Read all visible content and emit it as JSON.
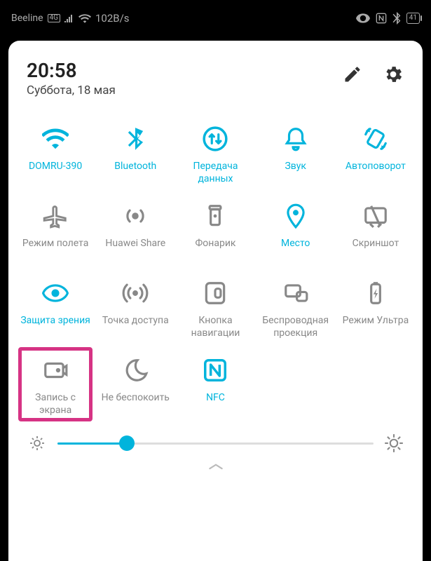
{
  "statusbar": {
    "carrier": "Beeline",
    "network_badge": "4G",
    "speed": "102B/s",
    "battery": "41"
  },
  "header": {
    "time": "20:58",
    "date": "Суббота, 18 мая"
  },
  "tiles": [
    {
      "id": "wifi",
      "label": "DOMRU-390",
      "active": true,
      "icon": "wifi"
    },
    {
      "id": "bluetooth",
      "label": "Bluetooth",
      "active": true,
      "icon": "bluetooth"
    },
    {
      "id": "data",
      "label": "Передача данных",
      "active": true,
      "icon": "data"
    },
    {
      "id": "sound",
      "label": "Звук",
      "active": true,
      "icon": "bell"
    },
    {
      "id": "rotate",
      "label": "Автоповорот",
      "active": true,
      "icon": "rotate"
    },
    {
      "id": "airplane",
      "label": "Режим полета",
      "active": false,
      "icon": "airplane"
    },
    {
      "id": "hshare",
      "label": "Huawei Share",
      "active": false,
      "icon": "share"
    },
    {
      "id": "torch",
      "label": "Фонарик",
      "active": false,
      "icon": "torch"
    },
    {
      "id": "location",
      "label": "Место",
      "active": true,
      "icon": "location"
    },
    {
      "id": "screenshot",
      "label": "Скриншот",
      "active": false,
      "icon": "screenshot"
    },
    {
      "id": "eyecare",
      "label": "Защита зрения",
      "active": true,
      "icon": "eye"
    },
    {
      "id": "hotspot",
      "label": "Точка доступа",
      "active": false,
      "icon": "hotspot"
    },
    {
      "id": "navkey",
      "label": "Кнопка навигации",
      "active": false,
      "icon": "navkey"
    },
    {
      "id": "cast",
      "label": "Беспроводная проекция",
      "active": false,
      "icon": "cast"
    },
    {
      "id": "ultra",
      "label": "Режим Ультра",
      "active": false,
      "icon": "battery-ultra"
    },
    {
      "id": "screenrec",
      "label": "Запись с экрана",
      "active": false,
      "icon": "screenrec",
      "highlighted": true
    },
    {
      "id": "dnd",
      "label": "Не беспокоить",
      "active": false,
      "icon": "moon"
    },
    {
      "id": "nfc",
      "label": "NFC",
      "active": true,
      "icon": "nfc"
    }
  ],
  "brightness": {
    "value": 22
  },
  "colors": {
    "active": "#00b4dc",
    "inactive": "#888888",
    "highlight": "#d63384"
  }
}
